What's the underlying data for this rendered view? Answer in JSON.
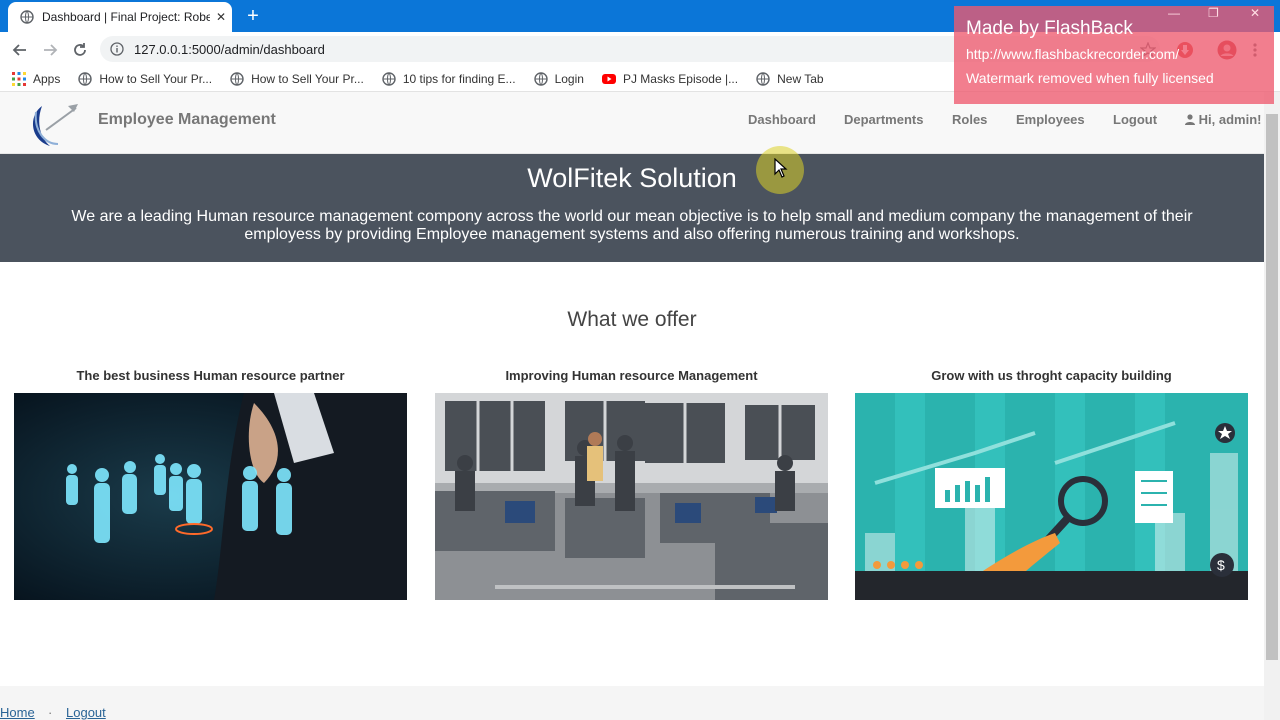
{
  "browser": {
    "tab_title": "Dashboard | Final Project: Robert",
    "url": "127.0.0.1:5000/admin/dashboard",
    "bookmarks": [
      {
        "label": "Apps",
        "icon": "apps-grid-icon"
      },
      {
        "label": "How to Sell Your Pr...",
        "icon": "globe-icon"
      },
      {
        "label": "How to Sell Your Pr...",
        "icon": "globe-icon"
      },
      {
        "label": "10 tips for finding E...",
        "icon": "globe-icon"
      },
      {
        "label": "Login",
        "icon": "globe-icon"
      },
      {
        "label": "PJ Masks Episode |...",
        "icon": "youtube-icon"
      },
      {
        "label": "New Tab",
        "icon": "globe-icon"
      }
    ]
  },
  "watermark": {
    "line1": "Made by FlashBack",
    "line2": "http://www.flashbackrecorder.com/",
    "line3": "Watermark removed when fully licensed"
  },
  "navbar": {
    "brand": "Employee Management",
    "links": [
      "Dashboard",
      "Departments",
      "Roles",
      "Employees",
      "Logout"
    ],
    "user": "Hi, admin!"
  },
  "hero": {
    "title": "WolFitek Solution",
    "text": "We are a leading Human resource management compony across the world our mean objective is to help small and medium company the management of their employess by providing Employee management systems and also offering numerous training and workshops."
  },
  "offer": {
    "title": "What we offer",
    "cards": [
      {
        "title": "The best business Human resource partner",
        "image": "glowing-people-businessman-image"
      },
      {
        "title": "Improving Human resource Management",
        "image": "office-cubicles-image"
      },
      {
        "title": "Grow with us throght capacity building",
        "image": "growth-magnifier-image"
      }
    ]
  },
  "footer": {
    "links": [
      "Home",
      "Logout"
    ],
    "separator": "·"
  },
  "colors": {
    "tabstrip": "#0b76d8",
    "hero_bg": "#4b535e",
    "navbar_bg": "#f8f8f8",
    "link": "#2a6496"
  }
}
